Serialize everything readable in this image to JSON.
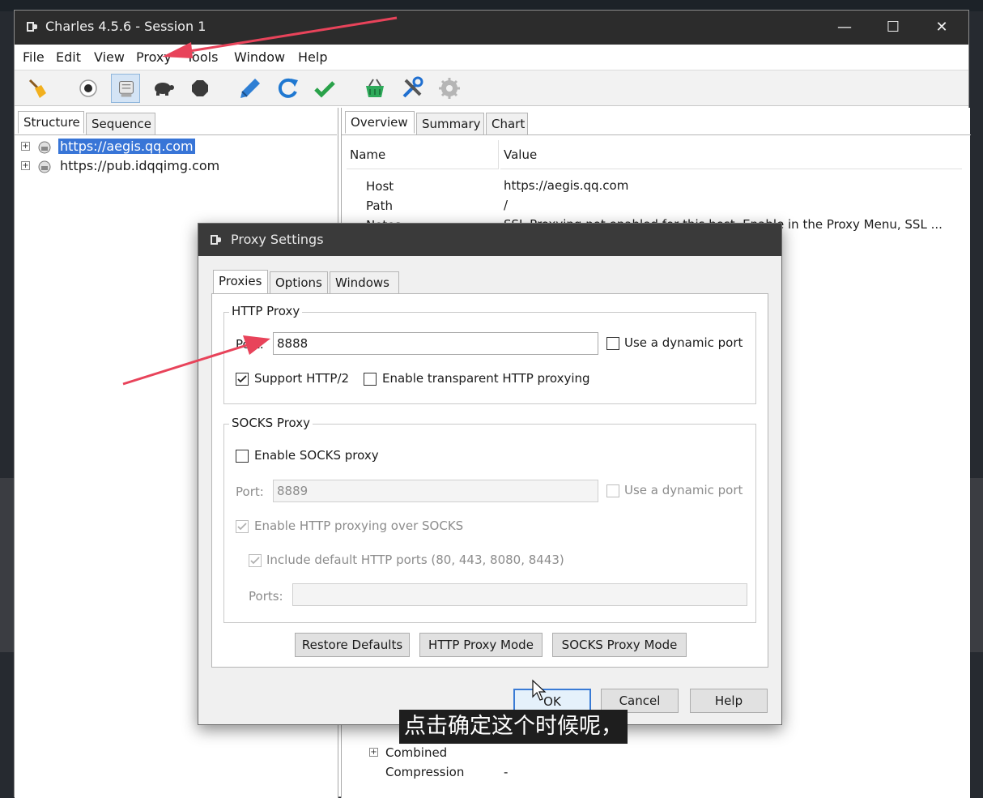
{
  "window": {
    "title": "Charles 4.5.6 - Session 1",
    "minimize": "—",
    "maximize": "☐",
    "close": "✕"
  },
  "menu": [
    "File",
    "Edit",
    "View",
    "Proxy",
    "Tools",
    "Window",
    "Help"
  ],
  "toolbar": [
    "broom-icon",
    "record-icon",
    "throttle-icon",
    "turtle-icon",
    "stop-icon",
    "pen-icon",
    "refresh-icon",
    "check-icon",
    "basket-icon",
    "tools-icon",
    "gear-icon"
  ],
  "left": {
    "tabs": [
      "Structure",
      "Sequence"
    ],
    "tree": [
      {
        "label": "https://aegis.qq.com",
        "selected": true
      },
      {
        "label": "https://pub.idqqimg.com",
        "selected": false
      }
    ]
  },
  "right": {
    "tabs": [
      "Overview",
      "Summary",
      "Chart"
    ],
    "headers": {
      "name": "Name",
      "value": "Value"
    },
    "rows": [
      {
        "name": "Host",
        "value": "https://aegis.qq.com"
      },
      {
        "name": "Path",
        "value": "/"
      },
      {
        "name": "Notes",
        "value": "SSL Proxying not enabled for this host. Enable in the Proxy Menu, SSL ..."
      }
    ],
    "bottom_rows": [
      {
        "name": "Combined",
        "value": ""
      },
      {
        "name": "Compression",
        "value": "-"
      }
    ]
  },
  "dialog": {
    "title": "Proxy Settings",
    "tabs": [
      "Proxies",
      "Options",
      "Windows"
    ],
    "http": {
      "legend": "HTTP Proxy",
      "port_label": "Port:",
      "port_value": "8888",
      "dynamic_label": "Use a dynamic port",
      "http2_label": "Support HTTP/2",
      "transparent_label": "Enable transparent HTTP proxying"
    },
    "socks": {
      "legend": "SOCKS Proxy",
      "enable_label": "Enable SOCKS proxy",
      "port_label": "Port:",
      "port_value": "8889",
      "dynamic_label": "Use a dynamic port",
      "http_over_label": "Enable HTTP proxying over SOCKS",
      "include_label": "Include default HTTP ports (80, 443, 8080, 8443)",
      "ports_label": "Ports:",
      "ports_value": ""
    },
    "buttons": {
      "restore": "Restore Defaults",
      "http_mode": "HTTP Proxy Mode",
      "socks_mode": "SOCKS Proxy Mode"
    },
    "footer": {
      "ok": "OK",
      "cancel": "Cancel",
      "help": "Help"
    }
  },
  "subtitle": "点击确定这个时候呢，",
  "colors": {
    "selection": "#3875d7",
    "titlebar": "#2c2c2c",
    "arrow": "#e8435a"
  }
}
